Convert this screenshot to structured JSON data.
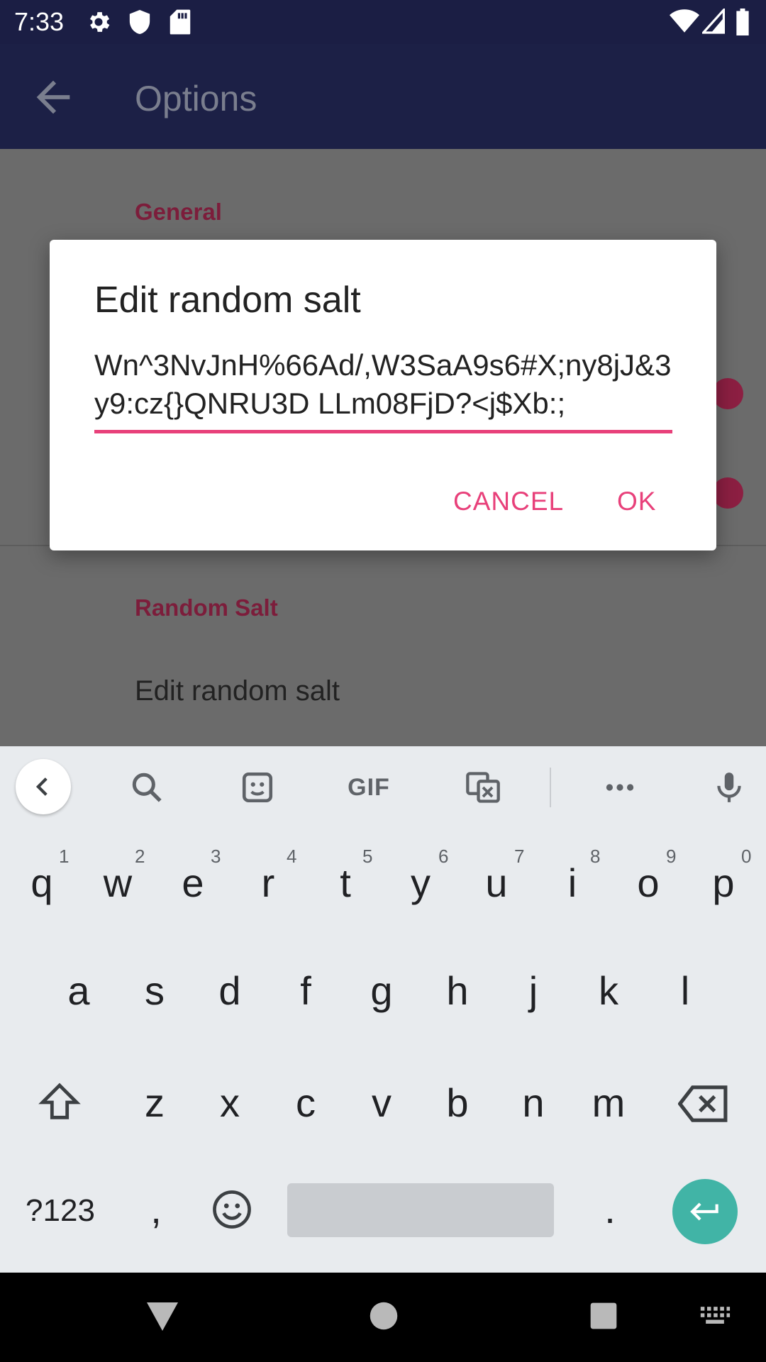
{
  "status_bar": {
    "time": "7:33",
    "left_icons": [
      "settings-icon",
      "shield-icon",
      "sd-card-icon"
    ],
    "right_icons": [
      "wifi-icon",
      "signal-icon",
      "battery-icon"
    ]
  },
  "app_bar": {
    "title": "Options",
    "back_icon": "arrow-back-icon"
  },
  "settings": {
    "category_general": "General",
    "category_random_salt": "Random Salt",
    "pref_edit_random_salt": "Edit random salt"
  },
  "dialog": {
    "title": "Edit random salt",
    "salt_value": "Wn^3NvJnH%66Ad/,W3SaA9s6#X;ny8jJ&3y9:cz{}QNRU3D LLm08FjD?<j$Xb:;",
    "cancel_label": "CANCEL",
    "ok_label": "OK",
    "accent_color": "#e8407a"
  },
  "keyboard": {
    "toolbar_icons": [
      "chevron-left-icon",
      "search-icon",
      "sticker-icon",
      "gif-icon",
      "translate-icon",
      "more-icon",
      "mic-icon"
    ],
    "gif_label": "GIF",
    "row1": [
      {
        "key": "q",
        "hint": "1"
      },
      {
        "key": "w",
        "hint": "2"
      },
      {
        "key": "e",
        "hint": "3"
      },
      {
        "key": "r",
        "hint": "4"
      },
      {
        "key": "t",
        "hint": "5"
      },
      {
        "key": "y",
        "hint": "6"
      },
      {
        "key": "u",
        "hint": "7"
      },
      {
        "key": "i",
        "hint": "8"
      },
      {
        "key": "o",
        "hint": "9"
      },
      {
        "key": "p",
        "hint": "0"
      }
    ],
    "row2": [
      "a",
      "s",
      "d",
      "f",
      "g",
      "h",
      "j",
      "k",
      "l"
    ],
    "row3": [
      "z",
      "x",
      "c",
      "v",
      "b",
      "n",
      "m"
    ],
    "symbols_label": "?123",
    "comma_label": ",",
    "period_label": ".",
    "enter_color": "#41b4a6"
  },
  "nav_bar": {
    "icons": [
      "back-triangle-icon",
      "home-circle-icon",
      "recents-square-icon",
      "keyboard-switch-icon"
    ]
  }
}
